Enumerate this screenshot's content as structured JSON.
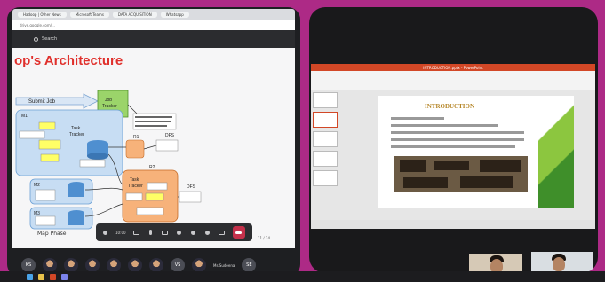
{
  "browser": {
    "tabs": [
      "Hadoop | Other News",
      "Microsoft Teams",
      "DATA ACQUISITION",
      "Whatsapp"
    ],
    "address": "drive.google.com/...",
    "search_label": "Search"
  },
  "slide": {
    "title": "op's Architecture",
    "diagram": {
      "submit_job": "Submit Job",
      "job_tracker": "Job\nTracker",
      "m1": "M1",
      "m2": "M2",
      "m3": "M3",
      "r1": "R1",
      "r2": "R2",
      "dfs1": "DFS",
      "dfs2": "DFS",
      "task_tracker": "Task\nTracker",
      "map_phase": "Map Phase"
    },
    "slide_number": "11 / 24"
  },
  "controls": {
    "time": "10:00"
  },
  "participants": [
    "KS",
    "",
    "",
    "",
    "",
    "",
    "",
    "VS",
    "",
    "",
    "SE"
  ],
  "participant_name": "Ms.Sudeena",
  "ppt": {
    "window_title": "INTRODUCTION.pptx - PowerPoint",
    "slide_title": "INTRODUCTION"
  },
  "colors": {
    "background": "#ad2a86",
    "slide_title": "#e0302c",
    "leave": "#c4314b",
    "accent_green": "#8cc63f"
  }
}
